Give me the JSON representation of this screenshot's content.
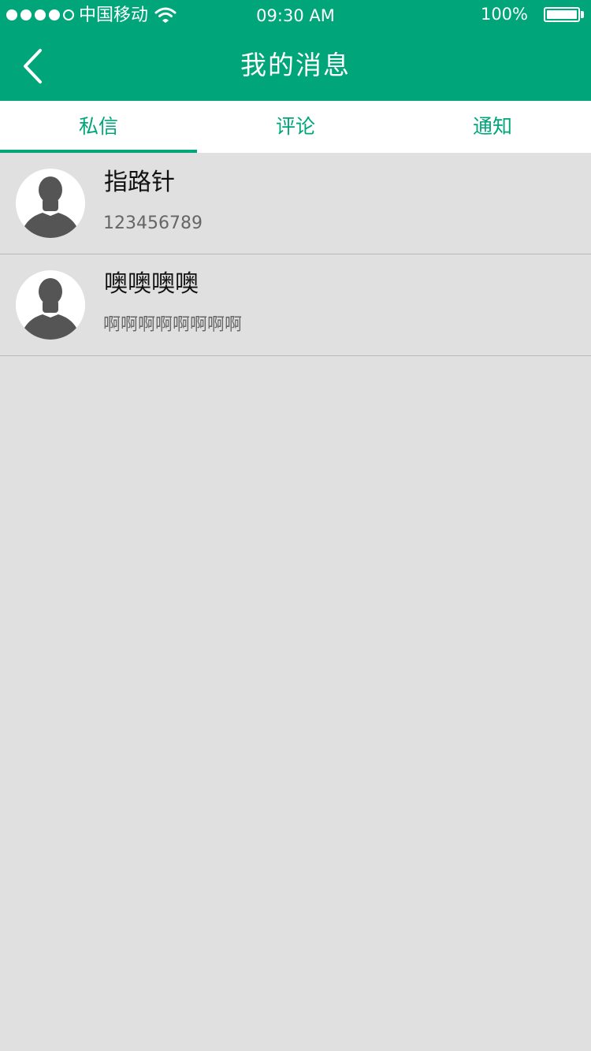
{
  "status_bar": {
    "carrier": "中国移动",
    "time": "09:30 AM",
    "battery": "100%",
    "icons": [
      "signal-dots",
      "wifi-icon",
      "battery-icon"
    ]
  },
  "nav": {
    "title": "我的消息",
    "back_icon": "back-chevron-icon"
  },
  "tabs": [
    {
      "label": "私信",
      "active": true
    },
    {
      "label": "评论",
      "active": false
    },
    {
      "label": "通知",
      "active": false
    }
  ],
  "messages": [
    {
      "name": "指路针",
      "preview": "123456789",
      "avatar_icon": "default-avatar-icon"
    },
    {
      "name": "噢噢噢噢",
      "preview": "啊啊啊啊啊啊啊啊",
      "avatar_icon": "default-avatar-icon"
    }
  ],
  "colors": {
    "primary": "#00a67a",
    "background": "#e0e0e0"
  }
}
